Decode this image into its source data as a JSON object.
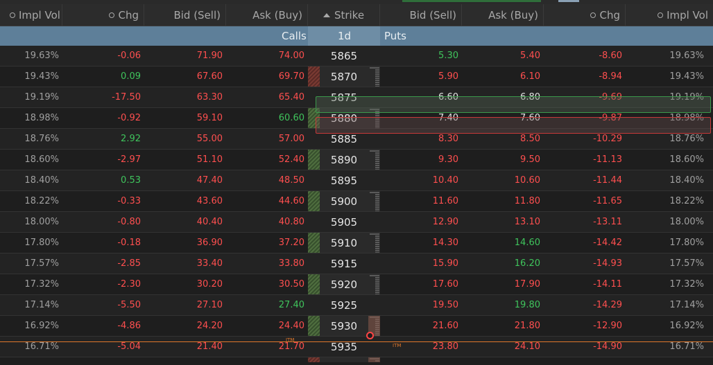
{
  "header": {
    "calls_columns": [
      "Impl Vol",
      "Chg",
      "Bid (Sell)",
      "Ask (Buy)"
    ],
    "strike_label": "Strike",
    "puts_columns": [
      "Bid (Sell)",
      "Ask (Buy)",
      "Chg",
      "Impl Vol"
    ]
  },
  "subheader": {
    "calls": "Calls",
    "expiry": "1d",
    "puts": "Puts"
  },
  "itm_label": "ITM",
  "colors": {
    "header_bar": "#5e7f99",
    "negative": "#ff4f4f",
    "positive": "#3fc45c",
    "itm_line": "#e0782b"
  },
  "rows": [
    {
      "c_iv": "19.63%",
      "c_chg": "-0.06",
      "c_bid": "71.90",
      "c_ask": "74.00",
      "strike": "5865",
      "p_bid": "5.30",
      "p_ask": "5.40",
      "p_chg": "-8.60",
      "p_iv": "19.63%"
    },
    {
      "c_iv": "19.43%",
      "c_chg": "0.09",
      "c_bid": "67.60",
      "c_ask": "69.70",
      "strike": "5870",
      "p_bid": "5.90",
      "p_ask": "6.10",
      "p_chg": "-8.94",
      "p_iv": "19.43%"
    },
    {
      "c_iv": "19.19%",
      "c_chg": "-17.50",
      "c_bid": "63.30",
      "c_ask": "65.40",
      "strike": "5875",
      "p_bid": "6.60",
      "p_ask": "6.80",
      "p_chg": "-9.69",
      "p_iv": "19.19%"
    },
    {
      "c_iv": "18.98%",
      "c_chg": "-0.92",
      "c_bid": "59.10",
      "c_ask": "60.60",
      "strike": "5880",
      "p_bid": "7.40",
      "p_ask": "7.60",
      "p_chg": "-9.87",
      "p_iv": "18.98%"
    },
    {
      "c_iv": "18.76%",
      "c_chg": "2.92",
      "c_bid": "55.00",
      "c_ask": "57.00",
      "strike": "5885",
      "p_bid": "8.30",
      "p_ask": "8.50",
      "p_chg": "-10.29",
      "p_iv": "18.76%"
    },
    {
      "c_iv": "18.60%",
      "c_chg": "-2.97",
      "c_bid": "51.10",
      "c_ask": "52.40",
      "strike": "5890",
      "p_bid": "9.30",
      "p_ask": "9.50",
      "p_chg": "-11.13",
      "p_iv": "18.60%"
    },
    {
      "c_iv": "18.40%",
      "c_chg": "0.53",
      "c_bid": "47.40",
      "c_ask": "48.50",
      "strike": "5895",
      "p_bid": "10.40",
      "p_ask": "10.60",
      "p_chg": "-11.44",
      "p_iv": "18.40%"
    },
    {
      "c_iv": "18.22%",
      "c_chg": "-0.33",
      "c_bid": "43.60",
      "c_ask": "44.60",
      "strike": "5900",
      "p_bid": "11.60",
      "p_ask": "11.80",
      "p_chg": "-11.65",
      "p_iv": "18.22%"
    },
    {
      "c_iv": "18.00%",
      "c_chg": "-0.80",
      "c_bid": "40.40",
      "c_ask": "40.80",
      "strike": "5905",
      "p_bid": "12.90",
      "p_ask": "13.10",
      "p_chg": "-13.11",
      "p_iv": "18.00%"
    },
    {
      "c_iv": "17.80%",
      "c_chg": "-0.18",
      "c_bid": "36.90",
      "c_ask": "37.20",
      "strike": "5910",
      "p_bid": "14.30",
      "p_ask": "14.60",
      "p_chg": "-14.42",
      "p_iv": "17.80%"
    },
    {
      "c_iv": "17.57%",
      "c_chg": "-2.85",
      "c_bid": "33.40",
      "c_ask": "33.80",
      "strike": "5915",
      "p_bid": "15.90",
      "p_ask": "16.20",
      "p_chg": "-14.93",
      "p_iv": "17.57%"
    },
    {
      "c_iv": "17.32%",
      "c_chg": "-2.30",
      "c_bid": "30.20",
      "c_ask": "30.50",
      "strike": "5920",
      "p_bid": "17.60",
      "p_ask": "17.90",
      "p_chg": "-14.11",
      "p_iv": "17.32%"
    },
    {
      "c_iv": "17.14%",
      "c_chg": "-5.50",
      "c_bid": "27.10",
      "c_ask": "27.40",
      "strike": "5925",
      "p_bid": "19.50",
      "p_ask": "19.80",
      "p_chg": "-14.29",
      "p_iv": "17.14%"
    },
    {
      "c_iv": "16.92%",
      "c_chg": "-4.86",
      "c_bid": "24.20",
      "c_ask": "24.40",
      "strike": "5930",
      "p_bid": "21.60",
      "p_ask": "21.80",
      "p_chg": "-12.90",
      "p_iv": "16.92%"
    },
    {
      "c_iv": "16.71%",
      "c_chg": "-5.04",
      "c_bid": "21.40",
      "c_ask": "21.70",
      "strike": "5935",
      "p_bid": "23.80",
      "p_ask": "24.10",
      "p_chg": "-14.90",
      "p_iv": "16.71%"
    }
  ]
}
